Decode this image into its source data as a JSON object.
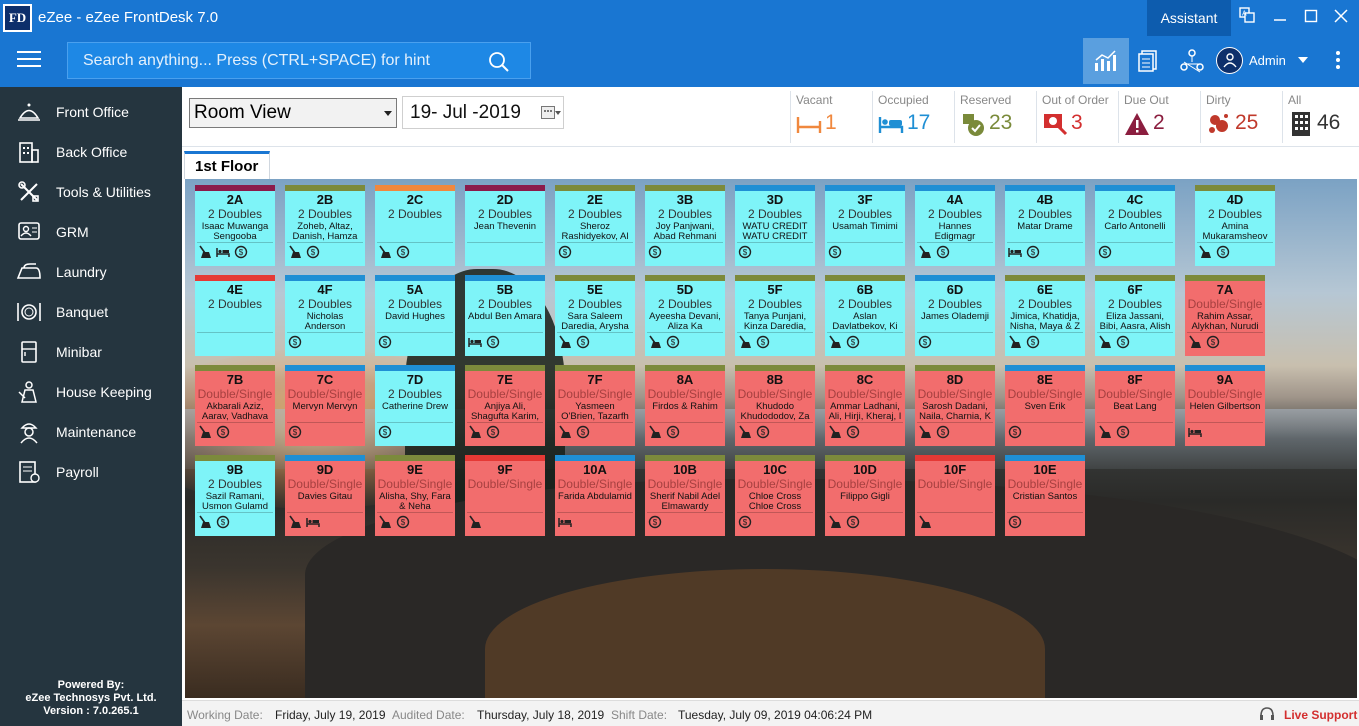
{
  "app": {
    "logo_text": "FD",
    "title": "eZee - eZee FrontDesk 7.0",
    "assistant_label": "Assistant"
  },
  "search": {
    "placeholder": "Search anything... Press (CTRL+SPACE) for hint"
  },
  "user": {
    "name": "Admin"
  },
  "sidebar": {
    "items": [
      {
        "label": "Front Office",
        "icon": "front-office-bell-icon"
      },
      {
        "label": "Back Office",
        "icon": "back-office-building-icon"
      },
      {
        "label": "Tools & Utilities",
        "icon": "tools-icon"
      },
      {
        "label": "GRM",
        "icon": "grm-icon"
      },
      {
        "label": "Laundry",
        "icon": "iron-icon"
      },
      {
        "label": "Banquet",
        "icon": "banquet-icon"
      },
      {
        "label": "Minibar",
        "icon": "minibar-icon"
      },
      {
        "label": "House Keeping",
        "icon": "housekeeping-icon"
      },
      {
        "label": "Maintenance",
        "icon": "maintenance-icon"
      },
      {
        "label": "Payroll",
        "icon": "payroll-icon"
      }
    ],
    "powered_line1": "Powered By:",
    "powered_line2": "eZee Technosys Pvt. Ltd.",
    "powered_line3": "Version : 7.0.265.1"
  },
  "toolbar": {
    "view_selected": "Room View",
    "date": "19- Jul -2019"
  },
  "stats": [
    {
      "label": "Vacant",
      "value": "1",
      "color": "#f0883e",
      "icon": "bed-empty-icon"
    },
    {
      "label": "Occupied",
      "value": "17",
      "color": "#1f8fd4",
      "icon": "bed-occupied-icon"
    },
    {
      "label": "Reserved",
      "value": "23",
      "color": "#7a8a3a",
      "icon": "reserved-check-icon"
    },
    {
      "label": "Out of Order",
      "value": "3",
      "color": "#d32f2f",
      "icon": "out-of-order-icon"
    },
    {
      "label": "Due Out",
      "value": "2",
      "color": "#8b1e3f",
      "icon": "due-out-warning-icon"
    },
    {
      "label": "Dirty",
      "value": "25",
      "color": "#c0392b",
      "icon": "dirty-icon"
    },
    {
      "label": "All",
      "value": "46",
      "color": "#333333",
      "icon": "all-rooms-grid-icon"
    }
  ],
  "floor_tab": "1st Floor",
  "rooms": [
    {
      "no": "2A",
      "type": "2 Doubles",
      "guest": "Isaac Muwanga Sengooba",
      "bar": "#8b1a4a",
      "bg": "#7ef4f8",
      "icons": [
        "broom",
        "bed",
        "money"
      ]
    },
    {
      "no": "2B",
      "type": "2 Doubles",
      "guest": "Zoheb, Altaz, Danish, Hamza",
      "bar": "#7c8a3c",
      "bg": "#7ef4f8",
      "icons": [
        "broom",
        "money"
      ]
    },
    {
      "no": "2C",
      "type": "2 Doubles",
      "guest": "",
      "bar": "#f0883e",
      "bg": "#7ef4f8",
      "icons": [
        "broom",
        "money"
      ]
    },
    {
      "no": "2D",
      "type": "2 Doubles",
      "guest": "Jean Thevenin",
      "bar": "#8b1a4a",
      "bg": "#7ef4f8",
      "icons": []
    },
    {
      "no": "2E",
      "type": "2 Doubles",
      "guest": "Sheroz Rashidyekov, Al",
      "bar": "#7c8a3c",
      "bg": "#7ef4f8",
      "icons": [
        "money"
      ]
    },
    {
      "no": "3B",
      "type": "2 Doubles",
      "guest": "Joy Panjwani, Abad Rehmani",
      "bar": "#7c8a3c",
      "bg": "#7ef4f8",
      "icons": [
        "money"
      ]
    },
    {
      "no": "3D",
      "type": "2 Doubles",
      "guest": "WATU CREDIT WATU CREDIT",
      "bar": "#1f8fd4",
      "bg": "#7ef4f8",
      "icons": [
        "money"
      ]
    },
    {
      "no": "3F",
      "type": "2 Doubles",
      "guest": "Usamah Timimi",
      "bar": "#1f8fd4",
      "bg": "#7ef4f8",
      "icons": [
        "money"
      ]
    },
    {
      "no": "4A",
      "type": "2 Doubles",
      "guest": "Hannes Edigmagr",
      "bar": "#1f8fd4",
      "bg": "#7ef4f8",
      "icons": [
        "broom",
        "money"
      ]
    },
    {
      "no": "4B",
      "type": "2 Doubles",
      "guest": "Matar Drame",
      "bar": "#1f8fd4",
      "bg": "#7ef4f8",
      "icons": [
        "bed",
        "money"
      ]
    },
    {
      "no": "4C",
      "type": "2 Doubles",
      "guest": "Carlo Antonelli",
      "bar": "#1f8fd4",
      "bg": "#7ef4f8",
      "icons": [
        "money"
      ]
    },
    {
      "no": "4D",
      "type": "2 Doubles",
      "guest": "Amina Mukaramsheov",
      "bar": "#7c8a3c",
      "bg": "#7ef4f8",
      "icons": [
        "broom",
        "money"
      ]
    },
    {
      "no": "4E",
      "type": "2 Doubles",
      "guest": "",
      "bar": "#e53935",
      "bg": "#7ef4f8",
      "icons": []
    },
    {
      "no": "4F",
      "type": "2 Doubles",
      "guest": "Nicholas Anderson",
      "bar": "#1f8fd4",
      "bg": "#7ef4f8",
      "icons": [
        "money"
      ]
    },
    {
      "no": "5A",
      "type": "2 Doubles",
      "guest": "David Hughes",
      "bar": "#1f8fd4",
      "bg": "#7ef4f8",
      "icons": [
        "money"
      ]
    },
    {
      "no": "5B",
      "type": "2 Doubles",
      "guest": "Abdul Ben Amara",
      "bar": "#1f8fd4",
      "bg": "#7ef4f8",
      "icons": [
        "bed",
        "money"
      ]
    },
    {
      "no": "5E",
      "type": "2 Doubles",
      "guest": "Sara Saleem Daredia, Arysha",
      "bar": "#7c8a3c",
      "bg": "#7ef4f8",
      "icons": [
        "broom",
        "money"
      ]
    },
    {
      "no": "5D",
      "type": "2 Doubles",
      "guest": "Ayeesha Devani, Aliza Ka",
      "bar": "#7c8a3c",
      "bg": "#7ef4f8",
      "icons": [
        "broom",
        "money"
      ]
    },
    {
      "no": "5F",
      "type": "2 Doubles",
      "guest": "Tanya Punjani, Kinza Daredia,",
      "bar": "#7c8a3c",
      "bg": "#7ef4f8",
      "icons": [
        "broom",
        "money"
      ]
    },
    {
      "no": "6B",
      "type": "2 Doubles",
      "guest": "Aslan Davlatbekov, Ki",
      "bar": "#7c8a3c",
      "bg": "#7ef4f8",
      "icons": [
        "broom",
        "money"
      ]
    },
    {
      "no": "6D",
      "type": "2 Doubles",
      "guest": "James Olademji",
      "bar": "#1f8fd4",
      "bg": "#7ef4f8",
      "icons": [
        "money"
      ]
    },
    {
      "no": "6E",
      "type": "2 Doubles",
      "guest": "Jimica, Khatidja, Nisha, Maya & Z",
      "bar": "#7c8a3c",
      "bg": "#7ef4f8",
      "icons": [
        "broom",
        "money"
      ]
    },
    {
      "no": "6F",
      "type": "2 Doubles",
      "guest": "Eliza Jassani, Bibi, Aasra, Alish",
      "bar": "#7c8a3c",
      "bg": "#7ef4f8",
      "icons": [
        "broom",
        "money"
      ]
    },
    {
      "no": "7A",
      "type": "Double/Single",
      "guest": "Rahim Assar, Alykhan, Nurudi",
      "bar": "#7c8a3c",
      "bg": "#f26d6d",
      "icons": [
        "broom",
        "money"
      ]
    },
    {
      "no": "7B",
      "type": "Double/Single",
      "guest": "Akbarali Aziz, Aarav, Vadhava",
      "bar": "#7c8a3c",
      "bg": "#f26d6d",
      "icons": [
        "broom",
        "money"
      ]
    },
    {
      "no": "7C",
      "type": "Double/Single",
      "guest": "Mervyn Mervyn",
      "bar": "#1f8fd4",
      "bg": "#f26d6d",
      "icons": [
        "money"
      ]
    },
    {
      "no": "7D",
      "type": "2 Doubles",
      "guest": "Catherine Drew",
      "bar": "#1f8fd4",
      "bg": "#7ef4f8",
      "icons": [
        "money"
      ]
    },
    {
      "no": "7E",
      "type": "Double/Single",
      "guest": "Anjiya Ali, Shagufta Karim,",
      "bar": "#7c8a3c",
      "bg": "#f26d6d",
      "icons": [
        "broom",
        "money"
      ]
    },
    {
      "no": "7F",
      "type": "Double/Single",
      "guest": "Yasmeen O'Brien, Tazarfh",
      "bar": "#7c8a3c",
      "bg": "#f26d6d",
      "icons": [
        "broom",
        "money"
      ]
    },
    {
      "no": "8A",
      "type": "Double/Single",
      "guest": "Firdos & Rahim",
      "bar": "#7c8a3c",
      "bg": "#f26d6d",
      "icons": [
        "broom",
        "money"
      ]
    },
    {
      "no": "8B",
      "type": "Double/Single",
      "guest": "Khudodo Khudododov, Za",
      "bar": "#7c8a3c",
      "bg": "#f26d6d",
      "icons": [
        "broom",
        "money"
      ]
    },
    {
      "no": "8C",
      "type": "Double/Single",
      "guest": "Ammar Ladhani, Ali, Hirji, Kheraj, I",
      "bar": "#7c8a3c",
      "bg": "#f26d6d",
      "icons": [
        "broom",
        "money"
      ]
    },
    {
      "no": "8D",
      "type": "Double/Single",
      "guest": "Sarosh Dadani, Naila, Charnia, K",
      "bar": "#7c8a3c",
      "bg": "#f26d6d",
      "icons": [
        "broom",
        "money"
      ]
    },
    {
      "no": "8E",
      "type": "Double/Single",
      "guest": "Sven Erik",
      "bar": "#1f8fd4",
      "bg": "#f26d6d",
      "icons": [
        "money"
      ]
    },
    {
      "no": "8F",
      "type": "Double/Single",
      "guest": "Beat Lang",
      "bar": "#1f8fd4",
      "bg": "#f26d6d",
      "icons": [
        "broom",
        "money"
      ]
    },
    {
      "no": "9A",
      "type": "Double/Single",
      "guest": "Helen Gilbertson",
      "bar": "#1f8fd4",
      "bg": "#f26d6d",
      "icons": [
        "bed"
      ]
    },
    {
      "no": "9B",
      "type": "2 Doubles",
      "guest": "Sazil Ramani, Usmon Gulamd",
      "bar": "#7c8a3c",
      "bg": "#7ef4f8",
      "icons": [
        "broom",
        "money"
      ]
    },
    {
      "no": "9D",
      "type": "Double/Single",
      "guest": "Davies Gitau",
      "bar": "#1f8fd4",
      "bg": "#f26d6d",
      "icons": [
        "broom",
        "bed"
      ]
    },
    {
      "no": "9E",
      "type": "Double/Single",
      "guest": "Alisha, Shy, Fara & Neha",
      "bar": "#7c8a3c",
      "bg": "#f26d6d",
      "icons": [
        "broom",
        "money"
      ]
    },
    {
      "no": "9F",
      "type": "Double/Single",
      "guest": "",
      "bar": "#e53935",
      "bg": "#f26d6d",
      "icons": [
        "broom"
      ]
    },
    {
      "no": "10A",
      "type": "Double/Single",
      "guest": "Farida Abdulamid",
      "bar": "#1f8fd4",
      "bg": "#f26d6d",
      "icons": [
        "bed"
      ]
    },
    {
      "no": "10B",
      "type": "Double/Single",
      "guest": "Sherif Nabil Adel Elmawardy",
      "bar": "#7c8a3c",
      "bg": "#f26d6d",
      "icons": [
        "money"
      ]
    },
    {
      "no": "10C",
      "type": "Double/Single",
      "guest": "Chloe Cross Chloe Cross",
      "bar": "#7c8a3c",
      "bg": "#f26d6d",
      "icons": [
        "money"
      ]
    },
    {
      "no": "10D",
      "type": "Double/Single",
      "guest": "Filippo Gigli",
      "bar": "#7c8a3c",
      "bg": "#f26d6d",
      "icons": [
        "broom",
        "money"
      ]
    },
    {
      "no": "10F",
      "type": "Double/Single",
      "guest": "",
      "bar": "#e53935",
      "bg": "#f26d6d",
      "icons": [
        "broom"
      ]
    },
    {
      "no": "10E",
      "type": "Double/Single",
      "guest": "Cristian Santos",
      "bar": "#1f8fd4",
      "bg": "#f26d6d",
      "icons": [
        "money"
      ]
    }
  ],
  "status": {
    "working_label": "Working Date:",
    "working_value": "Friday, July 19, 2019",
    "audited_label": "Audited Date:",
    "audited_value": "Thursday, July 18, 2019",
    "shift_label": "Shift Date:",
    "shift_value": "Tuesday, July 09, 2019 04:06:24 PM",
    "live_support": "Live Support"
  }
}
